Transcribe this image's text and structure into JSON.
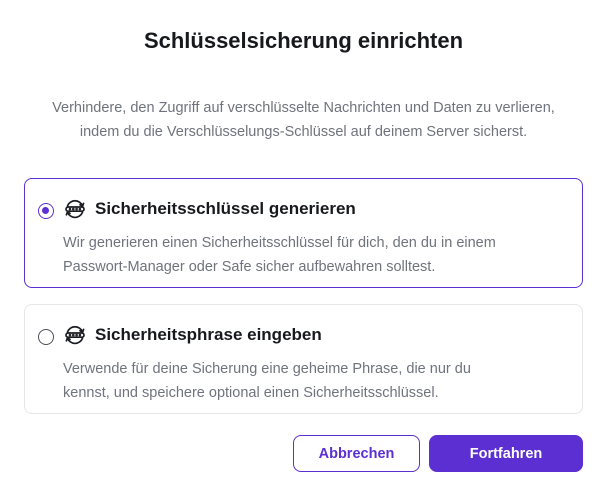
{
  "dialog": {
    "title": "Schlüsselsicherung einrichten",
    "description_line1": "Verhindere, den Zugriff auf verschlüsselte Nachrichten und Daten zu verlieren,",
    "description_line2": "indem du die Verschlüsselungs-Schlüssel auf deinem Server sicherst."
  },
  "options": [
    {
      "title": "Sicherheitsschlüssel generieren",
      "desc_line1": "Wir generieren einen Sicherheitsschlüssel für dich, den du in einem",
      "desc_line2": "Passwort-Manager oder Safe sicher aufbewahren solltest.",
      "selected": true,
      "icon": "key-sync-icon"
    },
    {
      "title": "Sicherheitsphrase eingeben",
      "desc_line1": "Verwende für deine Sicherung eine geheime Phrase, die nur du",
      "desc_line2": "kennst, und speichere optional einen Sicherheitsschlüssel.",
      "selected": false,
      "icon": "key-sync-icon"
    }
  ],
  "buttons": {
    "cancel_label": "Abbrechen",
    "continue_label": "Fortfahren"
  },
  "colors": {
    "accent": "#5b2fd1",
    "text": "#17191c",
    "muted": "#6f737d",
    "border": "#e4e6ea"
  }
}
